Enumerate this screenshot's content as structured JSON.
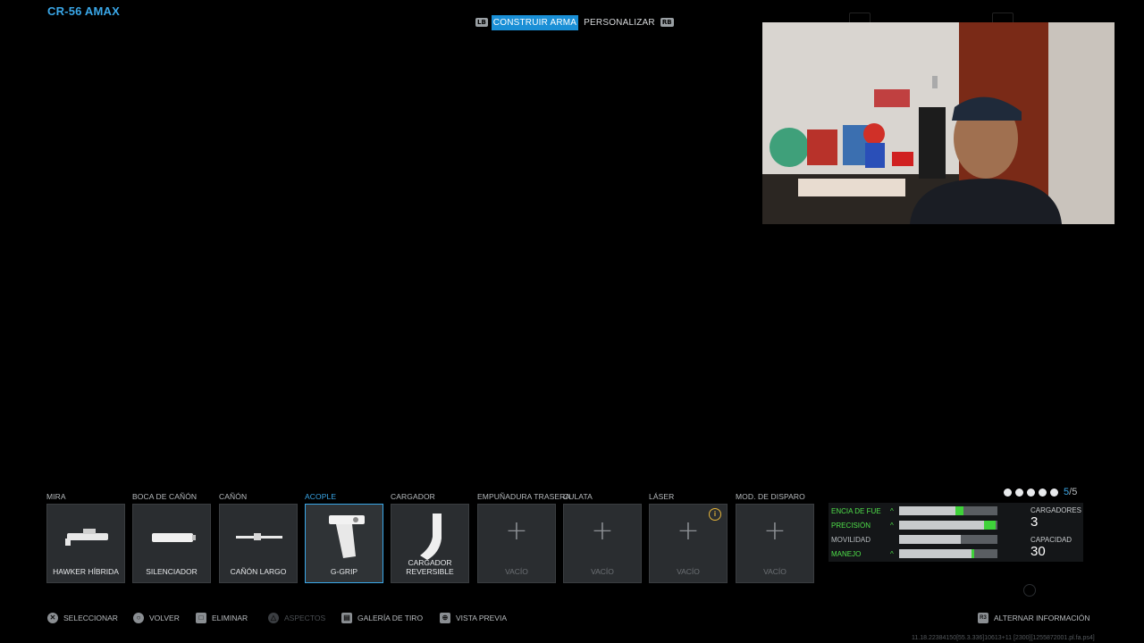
{
  "header": {
    "weapon_name": "CR-56 AMAX",
    "left_bumper": "LB",
    "right_bumper": "RB",
    "tabs": [
      {
        "label": "CONSTRUIR ARMA",
        "active": true
      },
      {
        "label": "PERSONALIZAR",
        "active": false
      }
    ]
  },
  "slots": [
    {
      "category": "MIRA",
      "name": "HAWKER HÍBRIDA",
      "icon": "hybrid-sight-icon",
      "empty": false,
      "active": false
    },
    {
      "category": "BOCA DE CAÑÓN",
      "name": "SILENCIADOR",
      "icon": "suppressor-icon",
      "empty": false,
      "active": false
    },
    {
      "category": "CAÑÓN",
      "name": "CAÑÓN LARGO",
      "icon": "long-barrel-icon",
      "empty": false,
      "active": false
    },
    {
      "category": "ACOPLE",
      "name": "G-GRIP",
      "icon": "foregrip-icon",
      "empty": false,
      "active": true
    },
    {
      "category": "CARGADOR",
      "name": "CARGADOR REVERSIBLE",
      "icon": "magazine-icon",
      "empty": false,
      "active": false
    },
    {
      "category": "EMPUÑADURA TRASERA",
      "name": "VACÍO",
      "icon": "plus-icon",
      "empty": true,
      "active": false
    },
    {
      "category": "CULATA",
      "name": "VACÍO",
      "icon": "plus-icon",
      "empty": true,
      "active": false
    },
    {
      "category": "LÁSER",
      "name": "VACÍO",
      "icon": "plus-icon",
      "empty": true,
      "active": false,
      "info": "i"
    },
    {
      "category": "MOD. DE DISPARO",
      "name": "VACÍO",
      "icon": "plus-icon",
      "empty": true,
      "active": false
    }
  ],
  "attachments_count": {
    "used": "5",
    "total": "5",
    "separator": "/"
  },
  "stats": [
    {
      "label": "ENCIA DE FUE",
      "base": 0.57,
      "bonus": 0.08,
      "arrow": "^",
      "green": true
    },
    {
      "label": "PRECISIÓN",
      "base": 0.86,
      "bonus": 0.12,
      "arrow": "^",
      "green": true
    },
    {
      "label": "MOVILIDAD",
      "base": 0.63,
      "bonus": 0,
      "arrow": "",
      "green": false
    },
    {
      "label": "MANEJO",
      "base": 0.74,
      "bonus": 0.03,
      "arrow": "^",
      "green": false
    }
  ],
  "side_stats": {
    "magazines_label": "CARGADORES",
    "magazines_value": "3",
    "capacity_label": "CAPACIDAD",
    "capacity_value": "30"
  },
  "bottom_actions": [
    {
      "label": "SELECCIONAR",
      "icon": "x-button-icon",
      "glyph": "✕",
      "disabled": false
    },
    {
      "label": "VOLVER",
      "icon": "circle-button-icon",
      "glyph": "○",
      "disabled": false
    },
    {
      "label": "ELIMINAR",
      "icon": "square-button-icon",
      "glyph": "□",
      "disabled": false
    },
    {
      "label": "ASPECTOS",
      "icon": "triangle-button-icon",
      "glyph": "△",
      "disabled": true
    },
    {
      "label": "GALERÍA DE TIRO",
      "icon": "touchpad-icon",
      "glyph": "▤",
      "disabled": false
    },
    {
      "label": "VISTA PREVIA",
      "icon": "preview-icon",
      "glyph": "⊕",
      "disabled": false
    }
  ],
  "toggle_info": {
    "label": "ALTERNAR INFORMACIÓN",
    "icon": "r3-button-icon",
    "glyph": "R3"
  },
  "version_text": "11.18.22384150[55.3.336]10613+11 [2300][1255872001.pl.fa.ps4]",
  "colors": {
    "accent": "#3aa7e8",
    "positive": "#3fd23a",
    "warning": "#e4b43a"
  }
}
